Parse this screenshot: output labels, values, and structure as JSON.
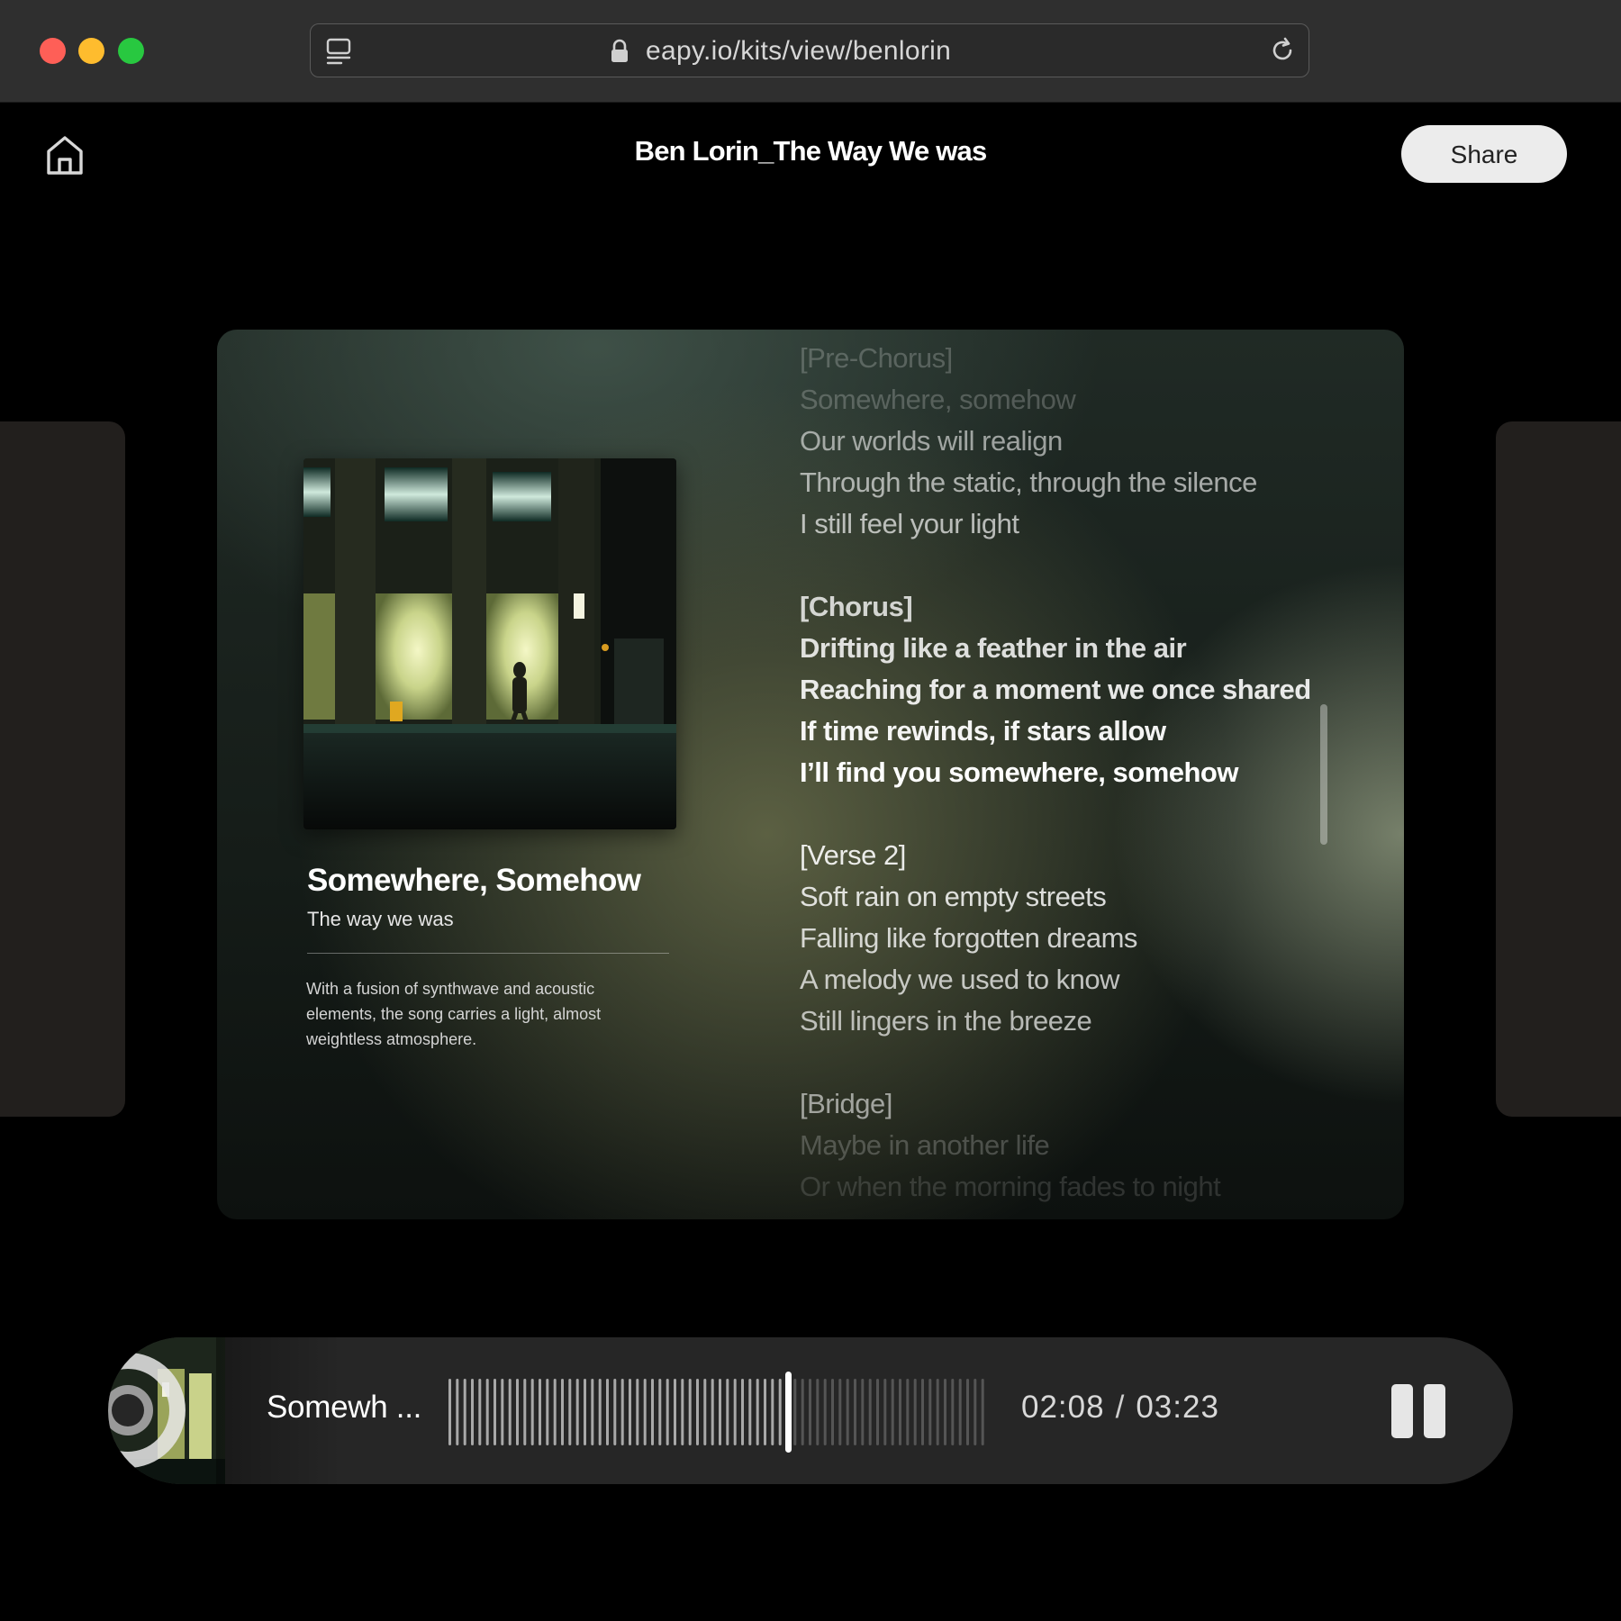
{
  "browser": {
    "url": "eapy.io/kits/view/benlorin"
  },
  "header": {
    "title": "Ben Lorin_The Way We was",
    "share_label": "Share"
  },
  "song": {
    "title": "Somewhere, Somehow",
    "album": "The way we was",
    "description": "With a fusion of synthwave and acoustic elements, the song carries a light, almost weightless atmosphere."
  },
  "lyrics": [
    "[Pre-Chorus]",
    "Somewhere, somehow",
    "Our worlds will realign",
    "Through the static, through the silence",
    "I still feel your light",
    "",
    "[Chorus]",
    "Drifting like a feather in the air",
    "Reaching for a moment we once shared",
    "If time rewinds, if stars allow",
    "I’ll find you somewhere, somehow",
    "",
    "[Verse 2]",
    "Soft rain on empty streets",
    "Falling like forgotten dreams",
    "A melody we used to know",
    "Still lingers in the breeze",
    "",
    "[Bridge]",
    "Maybe in another life",
    "Or when the morning fades to night"
  ],
  "player": {
    "title": "Somewh ...",
    "current_time": "02:08",
    "separator": "/",
    "total_time": "03:23",
    "progress": 0.63
  },
  "colors": {
    "red_light": "#fe5f57",
    "yellow_light": "#febc2e",
    "green_light": "#28c840"
  }
}
